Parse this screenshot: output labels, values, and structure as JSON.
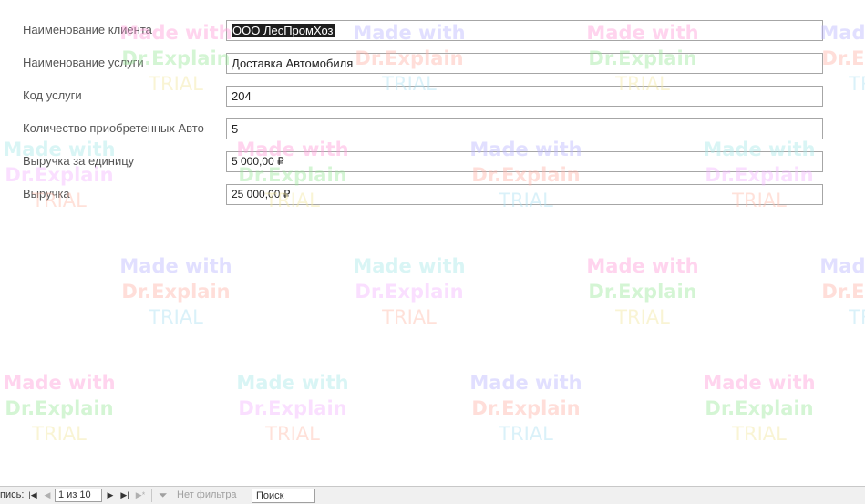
{
  "form": {
    "fields": [
      {
        "label": "Наименование клиента",
        "value": "ООО ЛесПромХоз"
      },
      {
        "label": "Наименование услуги",
        "value": "Доставка Автомобиля"
      },
      {
        "label": "Код услуги",
        "value": "204"
      },
      {
        "label": "Количество приобретенных Авто",
        "value": "5"
      },
      {
        "label": "Выручка за единицу",
        "value": "5 000,00 ₽"
      },
      {
        "label": "Выручка",
        "value": "25 000,00 ₽"
      }
    ]
  },
  "navbar": {
    "label": "пись:",
    "first_icon": "first-record-icon",
    "prev_icon": "previous-record-icon",
    "position": "1 из 10",
    "next_icon": "next-record-icon",
    "last_icon": "last-record-icon",
    "new_icon": "new-record-icon",
    "filter_icon": "funnel-icon",
    "filter_label": "Нет фильтра",
    "search_value": "Поиск"
  },
  "watermark": {
    "line1": "Made with",
    "line2": "Dr.Explain",
    "line3": "TRIAL"
  }
}
